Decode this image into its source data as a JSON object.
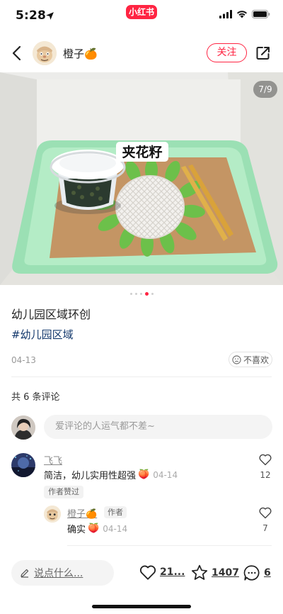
{
  "status_bar": {
    "time": "5:28",
    "app_badge": "小红书"
  },
  "header": {
    "author_name": "橙子🍊",
    "follow_label": "关注"
  },
  "photo": {
    "page_indicator": "7/9",
    "sign_text": "夹花籽",
    "total_pages": 9,
    "current_page": 7
  },
  "post": {
    "title": "幼儿园区域环创",
    "hashtag": "#幼儿园区域",
    "date": "04-13",
    "dislike_label": "不喜欢"
  },
  "comments": {
    "count_label": "共 6 条评论",
    "input_placeholder": "爱评论的人运气都不差~",
    "items": [
      {
        "name": "飞飞",
        "text": "简洁，幼儿实用性超强",
        "emoji": "🍑",
        "date": "04-14",
        "likes": "12",
        "badge": "作者赞过"
      }
    ],
    "replies": [
      {
        "name": "橙子🍊",
        "tag": "作者",
        "text": "确实",
        "emoji": "🍑",
        "date": "04-14",
        "likes": "7"
      }
    ]
  },
  "bottom_bar": {
    "say_placeholder": "说点什么...",
    "likes": "21...",
    "collects": "1407",
    "comments": "6"
  },
  "colors": {
    "accent": "#ff2442",
    "hashtag": "#13386c",
    "tray": "#9be0b4"
  },
  "icons": [
    "location-arrow-icon",
    "signal-icon",
    "wifi-icon",
    "battery-icon",
    "back-icon",
    "share-icon",
    "dislike-face-icon",
    "heart-icon",
    "star-icon",
    "comment-icon",
    "pencil-icon"
  ]
}
